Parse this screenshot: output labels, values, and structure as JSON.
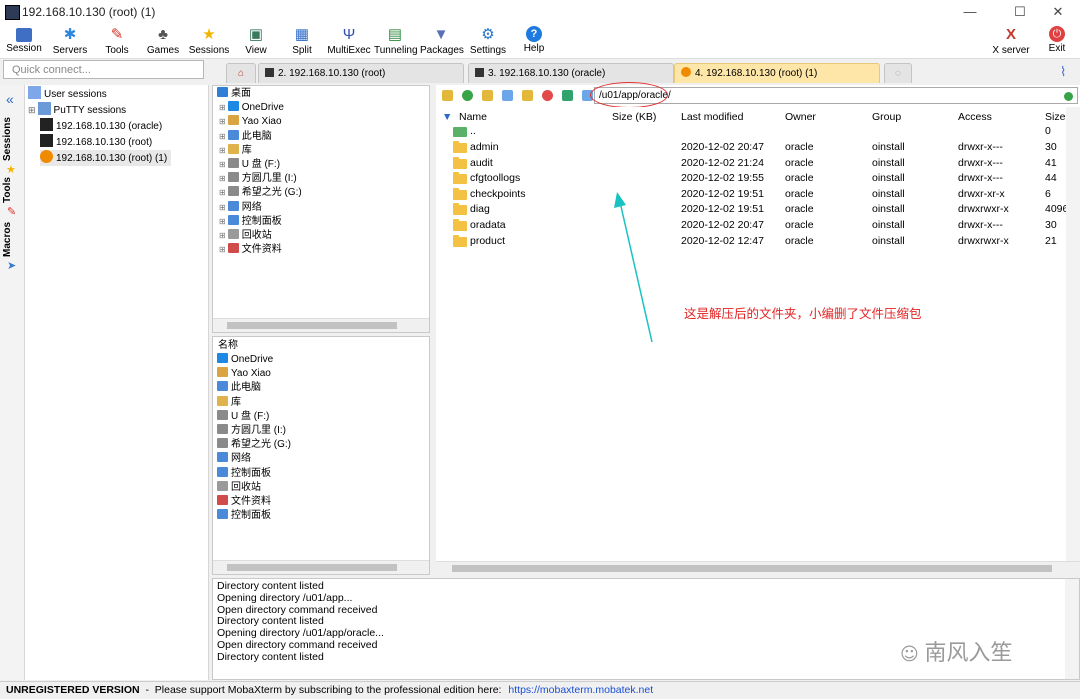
{
  "window": {
    "title": "192.168.10.130 (root) (1)",
    "min": "—",
    "max": "☐",
    "close": "✕"
  },
  "toolbar": [
    {
      "label": "Session",
      "icon": "session-icon"
    },
    {
      "label": "Servers",
      "icon": "servers-icon"
    },
    {
      "label": "Tools",
      "icon": "tools-icon"
    },
    {
      "label": "Games",
      "icon": "games-icon"
    },
    {
      "label": "Sessions",
      "icon": "star-icon"
    },
    {
      "label": "View",
      "icon": "view-icon"
    },
    {
      "label": "Split",
      "icon": "split-icon"
    },
    {
      "label": "MultiExec",
      "icon": "multiexec-icon"
    },
    {
      "label": "Tunneling",
      "icon": "tunneling-icon"
    },
    {
      "label": "Packages",
      "icon": "packages-icon"
    },
    {
      "label": "Settings",
      "icon": "settings-icon"
    },
    {
      "label": "Help",
      "icon": "help-icon"
    }
  ],
  "toolbar_right": [
    {
      "label": "X server",
      "icon": "xserver-icon"
    },
    {
      "label": "Exit",
      "icon": "exit-icon"
    }
  ],
  "quick_connect": {
    "placeholder": "Quick connect..."
  },
  "tabs": [
    {
      "label": "2. 192.168.10.130 (root)"
    },
    {
      "label": "3. 192.168.10.130 (oracle)"
    },
    {
      "label": "4. 192.168.10.130 (root) (1)"
    }
  ],
  "side_strip": {
    "sessions": "Sessions",
    "tools": "Tools",
    "macros": "Macros"
  },
  "sessions_tree": [
    {
      "label": "User sessions"
    },
    {
      "label": "PuTTY sessions"
    },
    {
      "label": "192.168.10.130 (oracle)"
    },
    {
      "label": "192.168.10.130 (root)"
    },
    {
      "label": "192.168.10.130 (root) (1)"
    }
  ],
  "explorer_tree": [
    {
      "label": "桌面",
      "color": "#2f7fd6"
    },
    {
      "label": "OneDrive",
      "color": "#1e88e5"
    },
    {
      "label": "Yao Xiao",
      "color": "#d9a441"
    },
    {
      "label": "此电脑",
      "color": "#4a8ad8"
    },
    {
      "label": "库",
      "color": "#e0b24b"
    },
    {
      "label": "U 盘 (F:)",
      "color": "#8a8a8a"
    },
    {
      "label": "方圆几里 (I:)",
      "color": "#8a8a8a"
    },
    {
      "label": "希望之光 (G:)",
      "color": "#8a8a8a"
    },
    {
      "label": "网络",
      "color": "#4a8ad8"
    },
    {
      "label": "控制面板",
      "color": "#4a8ad8"
    },
    {
      "label": "回收站",
      "color": "#9a9a9a"
    },
    {
      "label": "文件资料",
      "color": "#d24b4b"
    }
  ],
  "explorer_list": {
    "header": "名称",
    "items": [
      {
        "label": "OneDrive",
        "color": "#1e88e5"
      },
      {
        "label": "Yao Xiao",
        "color": "#d9a441"
      },
      {
        "label": "此电脑",
        "color": "#4a8ad8"
      },
      {
        "label": "库",
        "color": "#e0b24b"
      },
      {
        "label": "U 盘 (F:)",
        "color": "#8a8a8a"
      },
      {
        "label": "方圆几里 (I:)",
        "color": "#8a8a8a"
      },
      {
        "label": "希望之光 (G:)",
        "color": "#8a8a8a"
      },
      {
        "label": "网络",
        "color": "#4a8ad8"
      },
      {
        "label": "控制面板",
        "color": "#4a8ad8"
      },
      {
        "label": "回收站",
        "color": "#9a9a9a"
      },
      {
        "label": "文件资料",
        "color": "#d24b4b"
      },
      {
        "label": "控制面板",
        "color": "#4a8ad8"
      }
    ]
  },
  "sftp": {
    "path": "/u01/app/oracle/",
    "columns": {
      "name": "Name",
      "size": "Size (KB)",
      "modified": "Last modified",
      "owner": "Owner",
      "group": "Group",
      "access": "Access",
      "size2": "Size (B"
    },
    "parent": {
      "name": "..",
      "size2": "0"
    },
    "rows": [
      {
        "name": "admin",
        "modified": "2020-12-02 20:47",
        "owner": "oracle",
        "group": "oinstall",
        "access": "drwxr-x---",
        "size2": "30"
      },
      {
        "name": "audit",
        "modified": "2020-12-02 21:24",
        "owner": "oracle",
        "group": "oinstall",
        "access": "drwxr-x---",
        "size2": "41"
      },
      {
        "name": "cfgtoollogs",
        "modified": "2020-12-02 19:55",
        "owner": "oracle",
        "group": "oinstall",
        "access": "drwxr-x---",
        "size2": "44"
      },
      {
        "name": "checkpoints",
        "modified": "2020-12-02 19:51",
        "owner": "oracle",
        "group": "oinstall",
        "access": "drwxr-xr-x",
        "size2": "6"
      },
      {
        "name": "diag",
        "modified": "2020-12-02 19:51",
        "owner": "oracle",
        "group": "oinstall",
        "access": "drwxrwxr-x",
        "size2": "4096"
      },
      {
        "name": "oradata",
        "modified": "2020-12-02 20:47",
        "owner": "oracle",
        "group": "oinstall",
        "access": "drwxr-x---",
        "size2": "30"
      },
      {
        "name": "product",
        "modified": "2020-12-02 12:47",
        "owner": "oracle",
        "group": "oinstall",
        "access": "drwxrwxr-x",
        "size2": "21"
      }
    ]
  },
  "annotation": "这是解压后的文件夹，小编删了文件压缩包",
  "log": [
    "Directory content listed",
    "Opening directory /u01/app...",
    "Open directory command received",
    "Directory content listed",
    "Opening directory /u01/app/oracle...",
    "Open directory command received",
    "Directory content listed"
  ],
  "watermark": "南风入笙",
  "status": {
    "unregistered": "UNREGISTERED VERSION",
    "message": "  -  Please support MobaXterm by subscribing to the professional edition here:",
    "link": "https://mobaxterm.mobatek.net"
  }
}
